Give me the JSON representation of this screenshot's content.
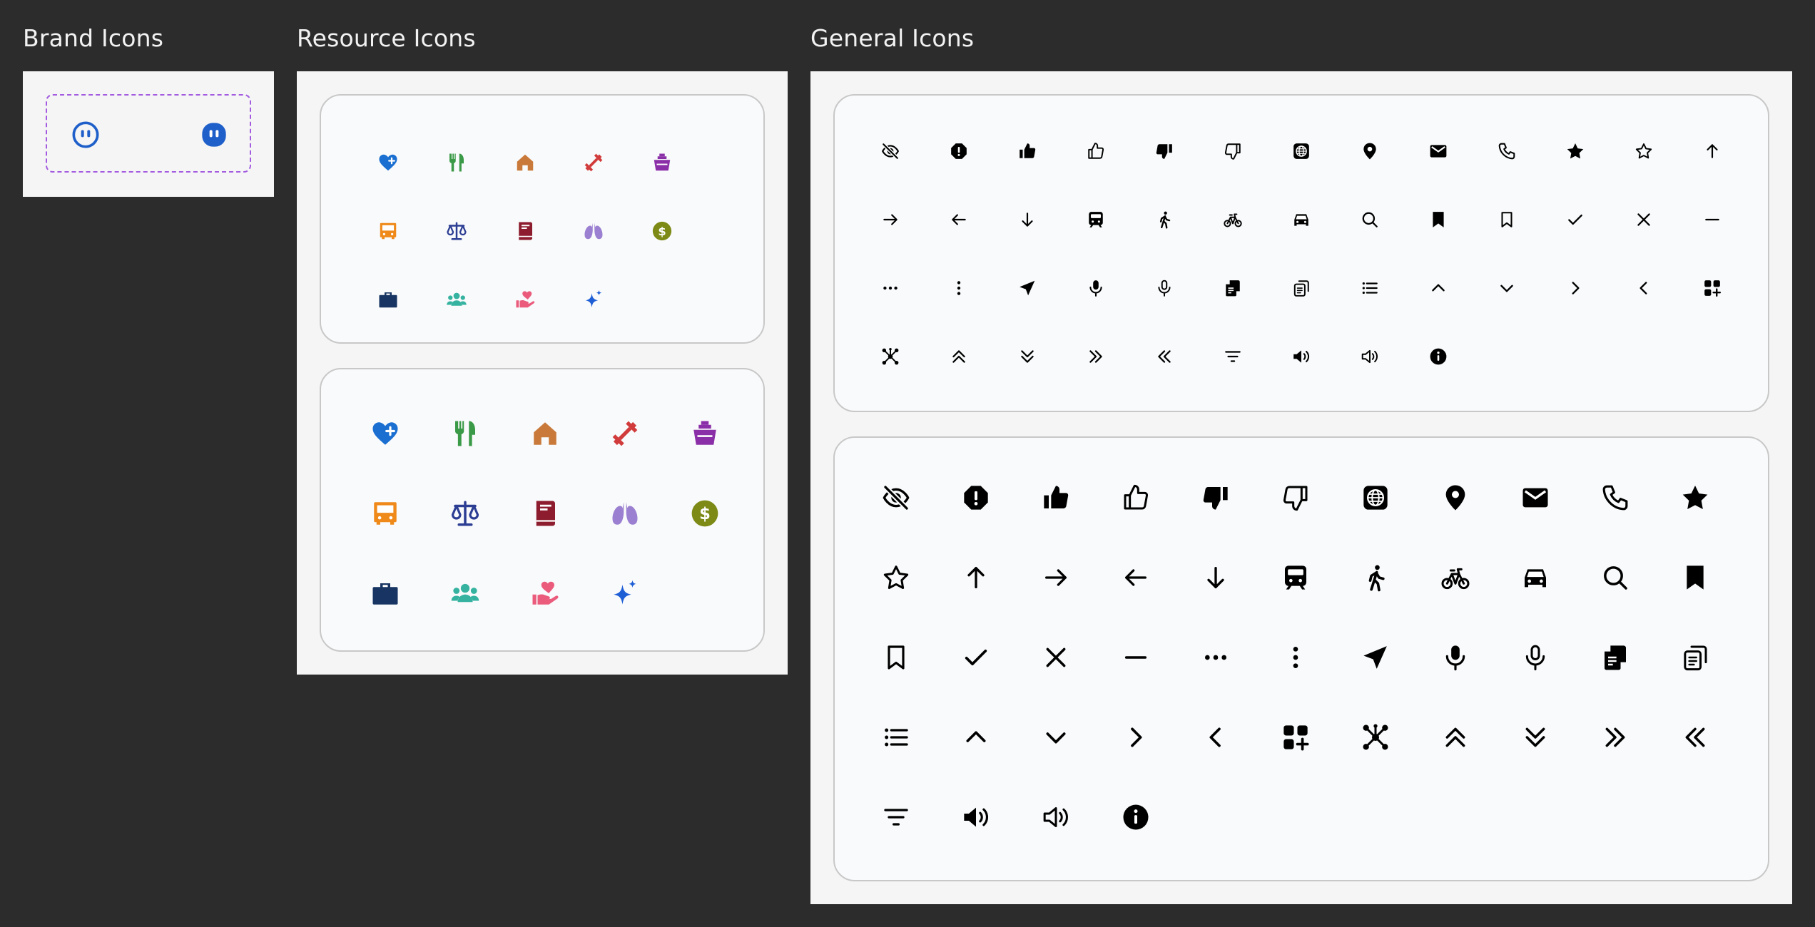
{
  "sections": {
    "brand": {
      "title": "Brand Icons",
      "icons": [
        {
          "name": "brand-outline-icon",
          "color": "#1f5fc9"
        },
        {
          "name": "brand-filled-icon",
          "color": "#1f5fc9"
        }
      ]
    },
    "resource": {
      "title": "Resource Icons",
      "icons": [
        {
          "name": "heart-plus-icon",
          "color": "#1a6fd1"
        },
        {
          "name": "fork-knife-icon",
          "color": "#3a9a47"
        },
        {
          "name": "home-icon",
          "color": "#c97a3a"
        },
        {
          "name": "dumbbell-icon",
          "color": "#d13b3b"
        },
        {
          "name": "gift-basket-icon",
          "color": "#8b2fa8"
        },
        {
          "name": "bus-icon",
          "color": "#ef8a1a"
        },
        {
          "name": "scale-icon",
          "color": "#2c3e94"
        },
        {
          "name": "book-icon",
          "color": "#8c1c2e"
        },
        {
          "name": "lungs-icon",
          "color": "#9b7fd1"
        },
        {
          "name": "dollar-coin-icon",
          "color": "#7d8a16"
        },
        {
          "name": "briefcase-icon",
          "color": "#173463"
        },
        {
          "name": "people-group-icon",
          "color": "#35b3a0"
        },
        {
          "name": "hand-heart-icon",
          "color": "#ea5b7c"
        },
        {
          "name": "sparkle-icon",
          "color": "#1f5fd6"
        }
      ]
    },
    "general": {
      "title": "General Icons",
      "icons": [
        "eye-off-icon",
        "alert-octagon-icon",
        "thumb-up-filled-icon",
        "thumb-up-outline-icon",
        "thumb-down-filled-icon",
        "thumb-down-outline-icon",
        "globe-icon",
        "location-pin-icon",
        "mail-icon",
        "phone-icon",
        "star-filled-icon",
        "star-outline-icon",
        "arrow-up-icon",
        "arrow-right-icon",
        "arrow-left-icon",
        "arrow-down-icon",
        "train-icon",
        "walking-icon",
        "bicycle-icon",
        "car-icon",
        "search-icon",
        "bookmark-filled-icon",
        "bookmark-outline-icon",
        "check-icon",
        "close-icon",
        "minus-icon",
        "more-horizontal-icon",
        "more-vertical-icon",
        "send-icon",
        "microphone-filled-icon",
        "microphone-outline-icon",
        "copy-filled-icon",
        "copy-outline-icon",
        "list-icon",
        "chevron-up-icon",
        "chevron-down-icon",
        "chevron-right-icon",
        "chevron-left-icon",
        "apps-add-icon",
        "network-icon",
        "chevrons-up-icon",
        "chevrons-down-icon",
        "chevrons-right-icon",
        "chevrons-left-icon",
        "filter-icon",
        "volume-filled-icon",
        "volume-outline-icon",
        "info-icon"
      ]
    }
  }
}
